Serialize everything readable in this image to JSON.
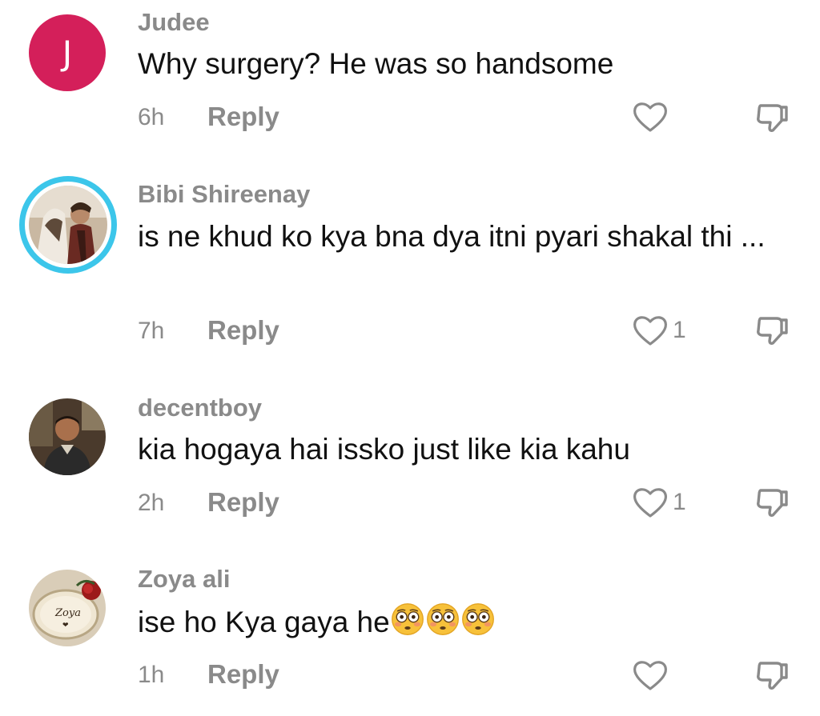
{
  "comments": [
    {
      "username": "Judee",
      "avatar_letter": "J",
      "text": "Why surgery? He was so handsome",
      "time": "6h",
      "reply_label": "Reply",
      "like_count": ""
    },
    {
      "username": "Bibi Shireenay",
      "text": "is ne khud ko kya bna dya itni pyari shakal thi ...",
      "time": "7h",
      "reply_label": "Reply",
      "like_count": "1"
    },
    {
      "username": "decentboy",
      "text": "kia hogaya hai issko just like kia kahu",
      "time": "2h",
      "reply_label": "Reply",
      "like_count": "1"
    },
    {
      "username": "Zoya ali",
      "avatar_text": "Zoya",
      "text": "ise ho Kya gaya he",
      "emojis": "flushed-face x3",
      "time": "1h",
      "reply_label": "Reply",
      "like_count": ""
    }
  ],
  "colors": {
    "avatar_j_bg": "#d41f5a",
    "story_ring": "#3cc6ea",
    "muted_text": "#8a8a8a",
    "primary_text": "#111111"
  }
}
